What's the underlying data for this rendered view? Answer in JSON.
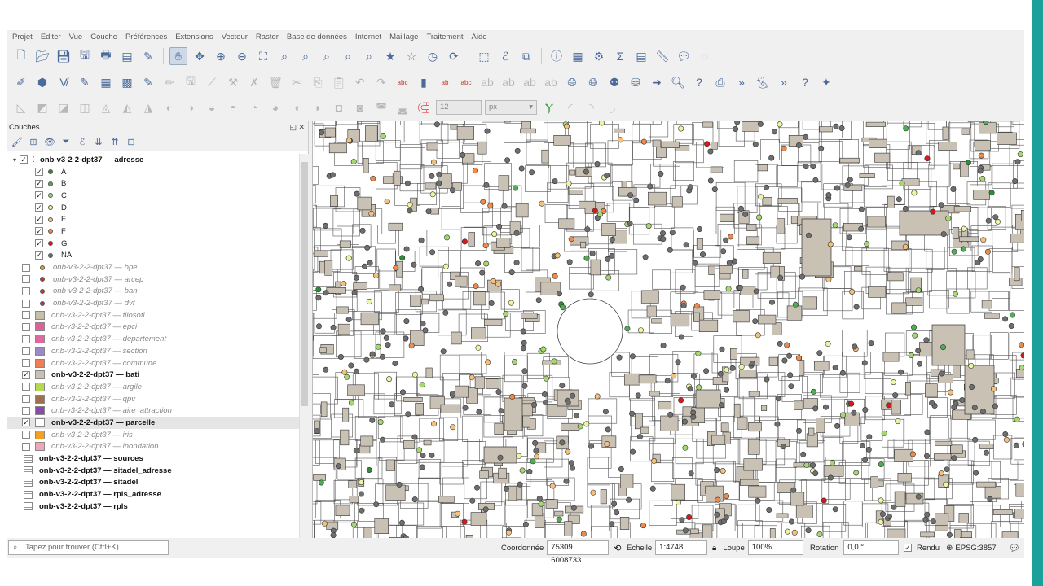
{
  "menu": [
    "Projet",
    "Éditer",
    "Vue",
    "Couche",
    "Préférences",
    "Extensions",
    "Vecteur",
    "Raster",
    "Base de données",
    "Internet",
    "Maillage",
    "Traitement",
    "Aide"
  ],
  "icons": {
    "toolbar1": [
      "new-project-icon",
      "open-project-icon",
      "save-project-icon",
      "save-as-icon",
      "print-layout-icon",
      "layout-manager-icon",
      "style-manager-icon",
      "pan-icon",
      "pan-to-selection-icon",
      "zoom-in-icon",
      "zoom-out-icon",
      "zoom-full-icon",
      "zoom-to-selection-icon",
      "zoom-to-layer-icon",
      "zoom-native-icon",
      "zoom-last-icon",
      "zoom-next-icon",
      "new-bookmark-icon",
      "show-bookmarks-icon",
      "temporal-controller-icon",
      "refresh-icon",
      "select-features-icon",
      "select-by-value-icon",
      "deselect-icon",
      "identify-icon",
      "attribute-table-icon",
      "toolbox-icon",
      "statistics-icon",
      "field-calculator-icon",
      "measure-icon",
      "annotation-icon",
      "map-tips-icon"
    ],
    "panel": [
      "open-styling-icon",
      "add-group-icon",
      "manage-themes-icon",
      "filter-legend-icon",
      "filter-expression-icon",
      "expand-all-icon",
      "collapse-all-icon",
      "remove-layer-icon"
    ]
  },
  "toolbar3": {
    "size_value": "12",
    "unit_value": "px"
  },
  "panel": {
    "title": "Couches",
    "group": {
      "name": "onb-v3-2-2-dpt37 — adresse"
    },
    "classes": [
      {
        "label": "A",
        "color": "#2e8b3a"
      },
      {
        "label": "B",
        "color": "#4caf50"
      },
      {
        "label": "C",
        "color": "#a5d86e"
      },
      {
        "label": "D",
        "color": "#eef5a0"
      },
      {
        "label": "E",
        "color": "#f5c07a"
      },
      {
        "label": "F",
        "color": "#f08a4b"
      },
      {
        "label": "G",
        "color": "#d7191c"
      },
      {
        "label": "NA",
        "color": "#6e6e6e"
      }
    ],
    "layers": [
      {
        "name": "onb-v3-2-2-dpt37 — bpe",
        "checked": false,
        "kind": "dot",
        "color": "#d8a040"
      },
      {
        "name": "onb-v3-2-2-dpt37 — arcep",
        "checked": false,
        "kind": "dot",
        "color": "#c0392b"
      },
      {
        "name": "onb-v3-2-2-dpt37 — ban",
        "checked": false,
        "kind": "dot",
        "color": "#c0392b"
      },
      {
        "name": "onb-v3-2-2-dpt37 — dvf",
        "checked": false,
        "kind": "dot",
        "color": "#a04060"
      },
      {
        "name": "onb-v3-2-2-dpt37 — filosofi",
        "checked": false,
        "kind": "square",
        "color": "#c8bfa8"
      },
      {
        "name": "onb-v3-2-2-dpt37 — epci",
        "checked": false,
        "kind": "square",
        "color": "#e0609a"
      },
      {
        "name": "onb-v3-2-2-dpt37 — departement",
        "checked": false,
        "kind": "square",
        "color": "#e06aa0"
      },
      {
        "name": "onb-v3-2-2-dpt37 — section",
        "checked": false,
        "kind": "square",
        "color": "#9a88c8"
      },
      {
        "name": "onb-v3-2-2-dpt37 — commune",
        "checked": false,
        "kind": "square",
        "color": "#ef7e55"
      },
      {
        "name": "onb-v3-2-2-dpt37 — bati",
        "checked": true,
        "kind": "square",
        "color": "#c9c1b4"
      },
      {
        "name": "onb-v3-2-2-dpt37 — argile",
        "checked": false,
        "kind": "square",
        "color": "#b8d850"
      },
      {
        "name": "onb-v3-2-2-dpt37 — qpv",
        "checked": false,
        "kind": "square",
        "color": "#a07050"
      },
      {
        "name": "onb-v3-2-2-dpt37 — aire_attraction",
        "checked": false,
        "kind": "square",
        "color": "#8a4aa8"
      },
      {
        "name": "onb-v3-2-2-dpt37 — parcelle",
        "checked": true,
        "kind": "square",
        "color": "#ffffff",
        "selected": true
      },
      {
        "name": "onb-v3-2-2-dpt37 — iris",
        "checked": false,
        "kind": "square",
        "color": "#f5a020"
      },
      {
        "name": "onb-v3-2-2-dpt37 — inondation",
        "checked": false,
        "kind": "square",
        "color": "#f0a8b8"
      }
    ],
    "tables": [
      "onb-v3-2-2-dpt37 — sources",
      "onb-v3-2-2-dpt37 — sitadel_adresse",
      "onb-v3-2-2-dpt37 — sitadel",
      "onb-v3-2-2-dpt37 — rpls_adresse",
      "onb-v3-2-2-dpt37 — rpls"
    ]
  },
  "status": {
    "search_placeholder": "Tapez pour trouver (Ctrl+K)",
    "coord_label": "Coordonnée",
    "coord_value": "75309  6008733",
    "scale_label": "Échelle",
    "scale_value": "1:4748",
    "magnifier_label": "Loupe",
    "magnifier_value": "100%",
    "rotation_label": "Rotation",
    "rotation_value": "0,0 °",
    "render_label": "Rendu",
    "crs_value": "EPSG:3857"
  },
  "colors": {
    "building": "#c9c1b4",
    "parcel_line": "#444444",
    "accent": "#1aa19a"
  }
}
